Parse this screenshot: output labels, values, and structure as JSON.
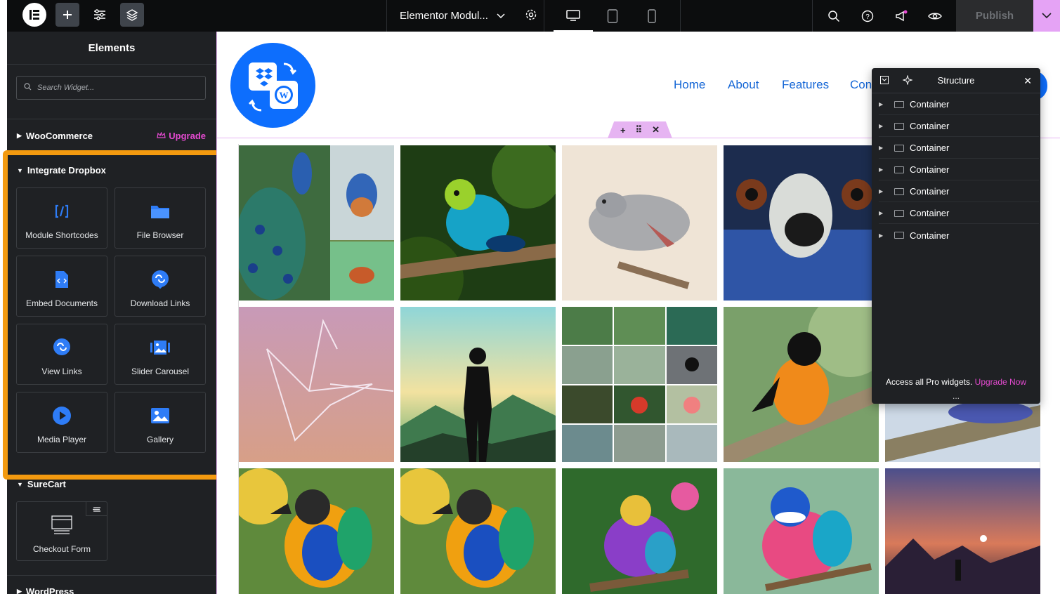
{
  "topbar": {
    "doc_title": "Elementor Modul...",
    "publish_label": "Publish"
  },
  "sidebar": {
    "title": "Elements",
    "search_placeholder": "Search Widget...",
    "categories": {
      "woocommerce": "WooCommerce",
      "upgrade": "Upgrade",
      "integrate_dropbox": "Integrate Dropbox",
      "surecart": "SureCart",
      "wordpress": "WordPress"
    },
    "dropbox_widgets": [
      {
        "label": "Module Shortcodes",
        "icon": "shortcode-icon"
      },
      {
        "label": "File Browser",
        "icon": "folder-icon"
      },
      {
        "label": "Embed Documents",
        "icon": "document-code-icon"
      },
      {
        "label": "Download Links",
        "icon": "download-links-icon"
      },
      {
        "label": "View Links",
        "icon": "view-links-icon"
      },
      {
        "label": "Slider Carousel",
        "icon": "slider-images-icon"
      },
      {
        "label": "Media Player",
        "icon": "play-icon"
      },
      {
        "label": "Gallery",
        "icon": "image-icon"
      }
    ],
    "surecart_widgets": [
      {
        "label": "Checkout Form",
        "icon": "checkout-form-icon"
      }
    ]
  },
  "canvas": {
    "nav": [
      "Home",
      "About",
      "Features",
      "Cont"
    ]
  },
  "structure": {
    "title": "Structure",
    "items": [
      "Container",
      "Container",
      "Container",
      "Container",
      "Container",
      "Container",
      "Container"
    ],
    "footer_text": "Access all Pro widgets.",
    "footer_link": "Upgrade Now",
    "ellipsis": "..."
  },
  "colors": {
    "topbar_bg": "#0c0d0e",
    "sidebar_bg": "#1f2124",
    "accent_pink": "#e44ad0",
    "highlight_orange": "#f39a0f",
    "widget_icon_blue": "#2e7cf6",
    "nav_blue": "#1466d6",
    "logo_blue": "#0d6efd"
  }
}
